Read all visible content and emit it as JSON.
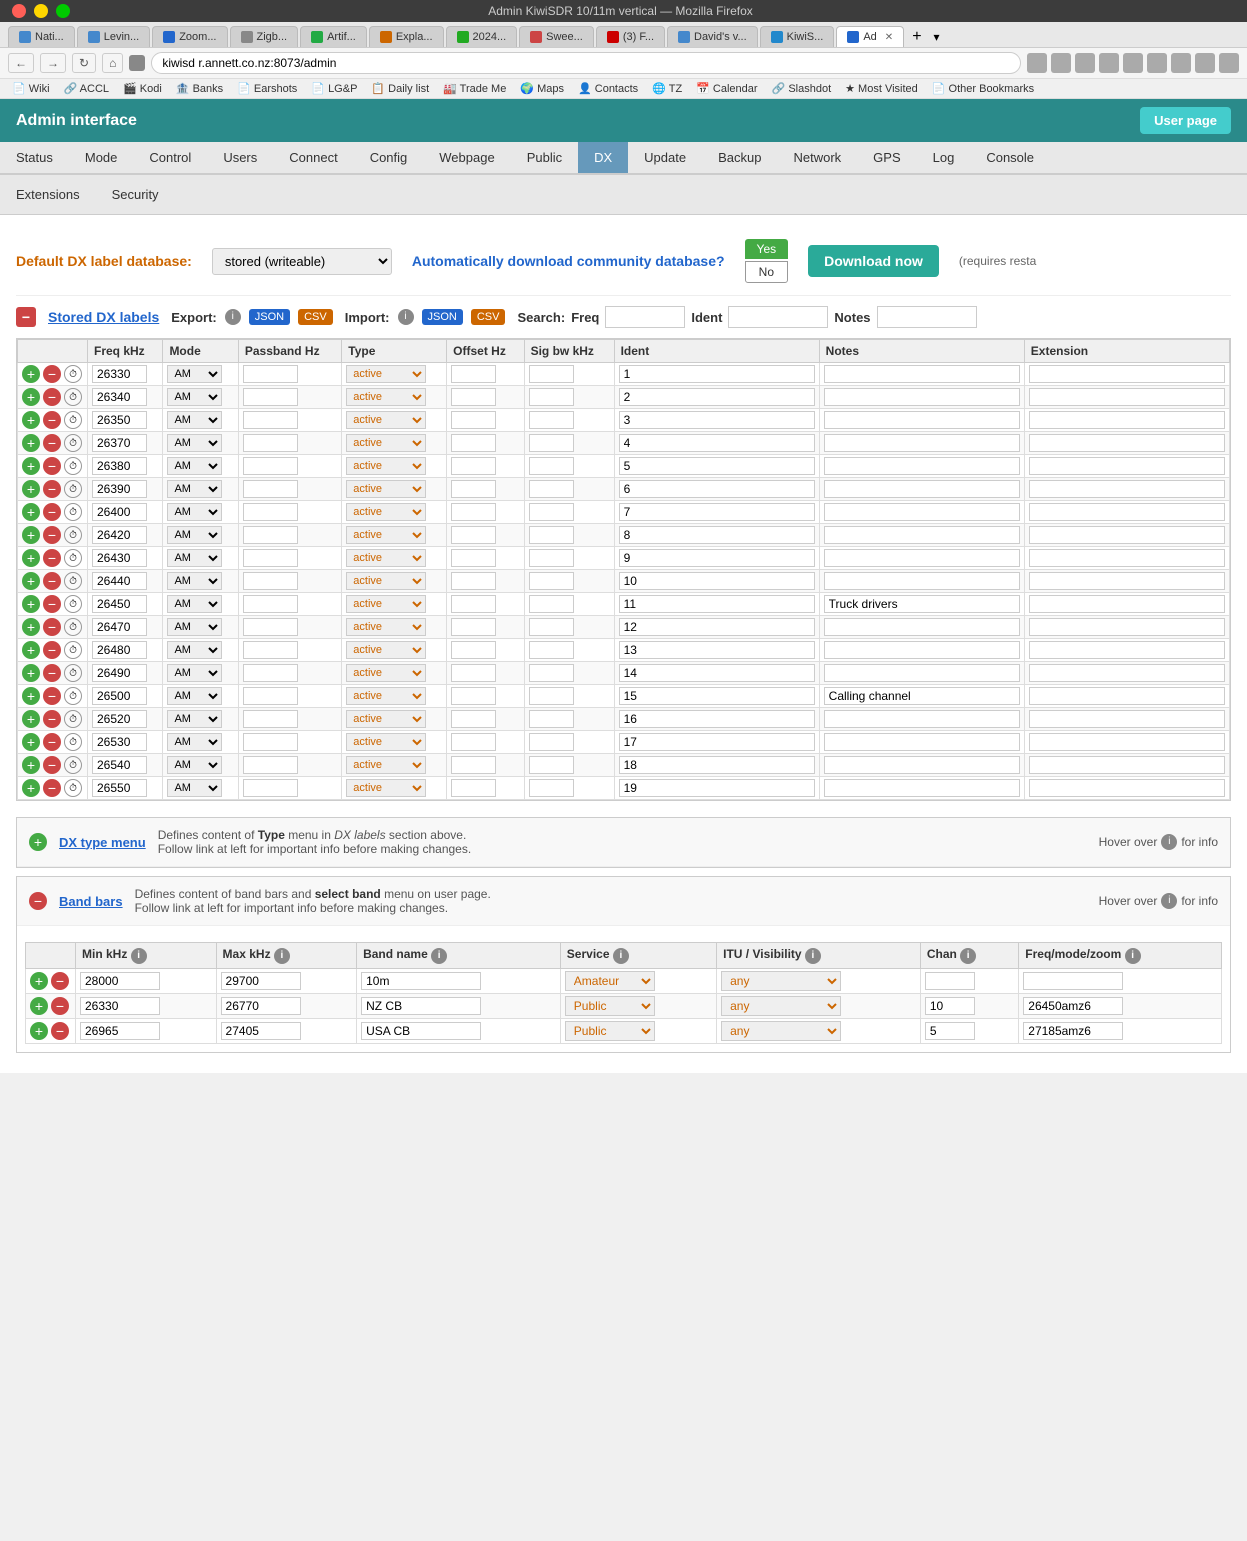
{
  "browser": {
    "title": "Admin KiwiSDR 10/11m vertical — Mozilla Firefox",
    "tabs": [
      {
        "label": "Nati...",
        "favicon_color": "#4488cc",
        "active": false
      },
      {
        "label": "Levin...",
        "favicon_color": "#4488cc",
        "active": false
      },
      {
        "label": "Zoom...",
        "favicon_color": "#2266cc",
        "active": false
      },
      {
        "label": "Zigb...",
        "favicon_color": "#888",
        "active": false
      },
      {
        "label": "Artif...",
        "favicon_color": "#22aa44",
        "active": false
      },
      {
        "label": "Expla...",
        "favicon_color": "#cc6600",
        "active": false
      },
      {
        "label": "2024...",
        "favicon_color": "#22aa22",
        "active": false
      },
      {
        "label": "Swee...",
        "favicon_color": "#cc4444",
        "active": false
      },
      {
        "label": "(3) F...",
        "favicon_color": "#cc0000",
        "active": false
      },
      {
        "label": "David's v...",
        "favicon_color": "#4488cc",
        "active": false
      },
      {
        "label": "KiwiS...",
        "favicon_color": "#2288cc",
        "active": false
      },
      {
        "label": "Ad ✕",
        "active": true,
        "favicon_color": "#2266cc"
      }
    ],
    "address": "kiwisd r.annett.co.nz:8073/admin",
    "bookmarks": [
      "Wiki",
      "ACCL",
      "Kodi",
      "Banks",
      "Earshots",
      "LG&P",
      "Daily list",
      "Trade Me",
      "Maps",
      "Contacts",
      "TZ",
      "Calendar",
      "Slashdot",
      "Most Visited",
      "Other Bookmarks"
    ]
  },
  "admin": {
    "title": "Admin interface",
    "user_page_btn": "User page"
  },
  "nav_tabs": {
    "tabs": [
      "Status",
      "Mode",
      "Control",
      "Users",
      "Connect",
      "Config",
      "Webpage",
      "Public",
      "DX",
      "Update",
      "Backup",
      "Network",
      "GPS",
      "Log",
      "Console"
    ],
    "active": "DX",
    "tabs_row2": [
      "Extensions",
      "Security"
    ]
  },
  "settings": {
    "dx_label_label": "Default DX label database:",
    "db_options": [
      "stored (writeable)"
    ],
    "db_selected": "stored (writeable)",
    "auto_download_label": "Automatically download community database?",
    "yes_label": "Yes",
    "no_label": "No",
    "download_now_label": "Download now",
    "requires_text": "(requires resta"
  },
  "stored_dx": {
    "collapse_btn": "−",
    "title": "Stored DX labels",
    "export_label": "Export:",
    "json_export": "JSON",
    "csv_export": "CSV",
    "import_label": "Import:",
    "json_import": "JSON",
    "csv_import": "CSV",
    "search_label": "Search:",
    "freq_label": "Freq",
    "ident_label": "Ident",
    "notes_label": "Notes"
  },
  "table": {
    "columns": [
      "Freq kHz",
      "Mode",
      "Passband Hz",
      "Type",
      "Offset Hz",
      "Sig bw kHz",
      "Ident",
      "Notes",
      "Extension"
    ],
    "rows": [
      {
        "freq": "26330",
        "mode": "AM",
        "passband": "",
        "type": "active",
        "offset": "",
        "sigbw": "",
        "ident": "1",
        "notes": "",
        "ext": ""
      },
      {
        "freq": "26340",
        "mode": "AM",
        "passband": "",
        "type": "active",
        "offset": "",
        "sigbw": "",
        "ident": "2",
        "notes": "",
        "ext": ""
      },
      {
        "freq": "26350",
        "mode": "AM",
        "passband": "",
        "type": "active",
        "offset": "",
        "sigbw": "",
        "ident": "3",
        "notes": "",
        "ext": ""
      },
      {
        "freq": "26370",
        "mode": "AM",
        "passband": "",
        "type": "active",
        "offset": "",
        "sigbw": "",
        "ident": "4",
        "notes": "",
        "ext": ""
      },
      {
        "freq": "26380",
        "mode": "AM",
        "passband": "",
        "type": "active",
        "offset": "",
        "sigbw": "",
        "ident": "5",
        "notes": "",
        "ext": ""
      },
      {
        "freq": "26390",
        "mode": "AM",
        "passband": "",
        "type": "active",
        "offset": "",
        "sigbw": "",
        "ident": "6",
        "notes": "",
        "ext": ""
      },
      {
        "freq": "26400",
        "mode": "AM",
        "passband": "",
        "type": "active",
        "offset": "",
        "sigbw": "",
        "ident": "7",
        "notes": "",
        "ext": ""
      },
      {
        "freq": "26420",
        "mode": "AM",
        "passband": "",
        "type": "active",
        "offset": "",
        "sigbw": "",
        "ident": "8",
        "notes": "",
        "ext": ""
      },
      {
        "freq": "26430",
        "mode": "AM",
        "passband": "",
        "type": "active",
        "offset": "",
        "sigbw": "",
        "ident": "9",
        "notes": "",
        "ext": ""
      },
      {
        "freq": "26440",
        "mode": "AM",
        "passband": "",
        "type": "active",
        "offset": "",
        "sigbw": "",
        "ident": "10",
        "notes": "",
        "ext": ""
      },
      {
        "freq": "26450",
        "mode": "AM",
        "passband": "",
        "type": "active",
        "offset": "",
        "sigbw": "",
        "ident": "11",
        "notes": "Truck drivers",
        "ext": ""
      },
      {
        "freq": "26470",
        "mode": "AM",
        "passband": "",
        "type": "active",
        "offset": "",
        "sigbw": "",
        "ident": "12",
        "notes": "",
        "ext": ""
      },
      {
        "freq": "26480",
        "mode": "AM",
        "passband": "",
        "type": "active",
        "offset": "",
        "sigbw": "",
        "ident": "13",
        "notes": "",
        "ext": ""
      },
      {
        "freq": "26490",
        "mode": "AM",
        "passband": "",
        "type": "active",
        "offset": "",
        "sigbw": "",
        "ident": "14",
        "notes": "",
        "ext": ""
      },
      {
        "freq": "26500",
        "mode": "AM",
        "passband": "",
        "type": "active",
        "offset": "",
        "sigbw": "",
        "ident": "15",
        "notes": "Calling channel",
        "ext": ""
      },
      {
        "freq": "26520",
        "mode": "AM",
        "passband": "",
        "type": "active",
        "offset": "",
        "sigbw": "",
        "ident": "16",
        "notes": "",
        "ext": ""
      },
      {
        "freq": "26530",
        "mode": "AM",
        "passband": "",
        "type": "active",
        "offset": "",
        "sigbw": "",
        "ident": "17",
        "notes": "",
        "ext": ""
      },
      {
        "freq": "26540",
        "mode": "AM",
        "passband": "",
        "type": "active",
        "offset": "",
        "sigbw": "",
        "ident": "18",
        "notes": "",
        "ext": ""
      },
      {
        "freq": "26550",
        "mode": "AM",
        "passband": "",
        "type": "active",
        "offset": "",
        "sigbw": "",
        "ident": "19",
        "notes": "",
        "ext": ""
      }
    ]
  },
  "dx_type_menu": {
    "expand_btn": "+",
    "title": "DX type menu",
    "desc": "Defines content of ",
    "desc_type": "Type",
    "desc_suffix": " menu in ",
    "desc_dx": "DX labels",
    "desc_end": " section above.",
    "desc_line2": "Follow link at left for important info before making changes.",
    "hover_text": "Hover over",
    "for_info": "for info"
  },
  "band_bars": {
    "collapse_btn": "−",
    "title": "Band bars",
    "desc": "Defines content of band bars and ",
    "desc_bold": "select band",
    "desc_end": " menu on user page.",
    "desc_line2": "Follow link at left for important info before making changes.",
    "hover_text": "Hover over",
    "for_info": "for info",
    "columns": [
      "Min kHz",
      "Max kHz",
      "Band name",
      "Service",
      "ITU / Visibility",
      "Chan",
      "Freq/mode/zoom"
    ],
    "rows": [
      {
        "min": "28000",
        "max": "29700",
        "name": "10m",
        "service": "Amateur",
        "itu": "any",
        "chan": "",
        "freq_zoom": ""
      },
      {
        "min": "26330",
        "max": "26770",
        "name": "NZ CB",
        "service": "Public",
        "itu": "any",
        "chan": "10",
        "freq_zoom": "26450amz6"
      },
      {
        "min": "26965",
        "max": "27405",
        "name": "USA CB",
        "service": "Public",
        "itu": "any",
        "chan": "5",
        "freq_zoom": "27185amz6"
      }
    ]
  }
}
